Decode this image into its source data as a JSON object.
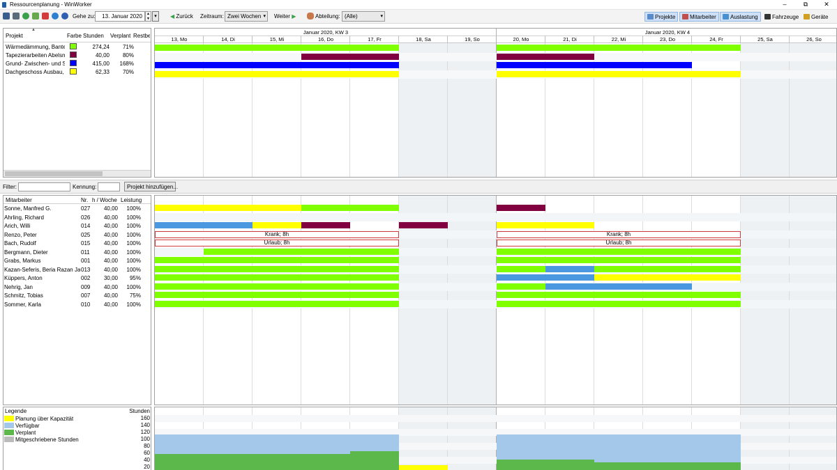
{
  "window": {
    "title": "Ressourcenplanung - WinWorker",
    "minimize": "–",
    "maximize": "⧉",
    "close": "✕"
  },
  "toolbar": {
    "icons": [
      "save-icon",
      "print-icon",
      "refresh-icon",
      "export-icon",
      "calendar-cancel-icon",
      "globe-icon",
      "help-icon"
    ],
    "goto_label": "Gehe zu:",
    "goto_date": "13. Januar 2020",
    "back_label": "Zurück",
    "range_label": "Zeitraum:",
    "range_value": "Zwei Wochen",
    "next_label": "Weiter",
    "dept_label": "Abteilung:",
    "dept_value": "(Alle)",
    "views": [
      {
        "label": "Projekte",
        "active": true
      },
      {
        "label": "Mitarbeiter",
        "active": true
      },
      {
        "label": "Auslastung",
        "active": true
      },
      {
        "label": "Fahrzeuge",
        "active": false
      },
      {
        "label": "Geräte",
        "active": false
      }
    ]
  },
  "projects": {
    "headers": {
      "name": "Projekt",
      "color": "Farbe",
      "hours": "Stunden",
      "planned": "Verplant",
      "rest": "Restbed"
    },
    "rows": [
      {
        "name": "Wärmedämmung, Banter",
        "color": "#80ff00",
        "hours": "274,24",
        "planned": "71%"
      },
      {
        "name": "Tapezierarbeiten Abelsma",
        "color": "#800040",
        "hours": "40,00",
        "planned": "80%"
      },
      {
        "name": "Grund- Zwischen- und Sc",
        "color": "#0000ff",
        "hours": "415,00",
        "planned": "168%"
      },
      {
        "name": "Dachgeschoss Ausbau, Ba",
        "color": "#ffff00",
        "hours": "62,33",
        "planned": "70%"
      }
    ]
  },
  "filter": {
    "filter_label": "Filter:",
    "kennung_label": "Kennung:",
    "add_button": "Projekt hinzufügen..."
  },
  "calendar": {
    "weeks": [
      "Januar 2020, KW 3",
      "Januar 2020, KW 4"
    ],
    "days": [
      "13, Mo",
      "14, Di",
      "15, Mi",
      "16, Do",
      "17, Fr",
      "18, Sa",
      "19, So",
      "20, Mo",
      "21, Di",
      "22, Mi",
      "23, Do",
      "24, Fr",
      "25, Sa",
      "26, So"
    ],
    "weekend_days": [
      5,
      6,
      12,
      13
    ]
  },
  "project_bars": [
    {
      "row": 0,
      "start": 0,
      "end": 5,
      "color": "#80ff00"
    },
    {
      "row": 0,
      "start": 7,
      "end": 12,
      "color": "#80ff00"
    },
    {
      "row": 1,
      "start": 3,
      "end": 5,
      "color": "#800040"
    },
    {
      "row": 1,
      "start": 7,
      "end": 9,
      "color": "#800040"
    },
    {
      "row": 2,
      "start": 0,
      "end": 5,
      "color": "#0000ff"
    },
    {
      "row": 2,
      "start": 7,
      "end": 11,
      "color": "#0000ff"
    },
    {
      "row": 3,
      "start": 0,
      "end": 5,
      "color": "#ffff00"
    },
    {
      "row": 3,
      "start": 7,
      "end": 12,
      "color": "#ffff00"
    }
  ],
  "employees": {
    "headers": {
      "name": "Mitarbeiter",
      "nr": "Nr.",
      "hweek": "h / Woche",
      "perf": "Leistung"
    },
    "rows": [
      {
        "name": "Sonne, Manfred G.",
        "nr": "027",
        "hweek": "40,00",
        "perf": "100%"
      },
      {
        "name": "Ahrling, Richard",
        "nr": "026",
        "hweek": "40,00",
        "perf": "100%"
      },
      {
        "name": "Arich, Willi",
        "nr": "014",
        "hweek": "40,00",
        "perf": "100%"
      },
      {
        "name": "Renzo, Peter",
        "nr": "025",
        "hweek": "40,00",
        "perf": "100%"
      },
      {
        "name": "Bach, Rudolf",
        "nr": "015",
        "hweek": "40,00",
        "perf": "100%"
      },
      {
        "name": "Bergmann, Dieter",
        "nr": "011",
        "hweek": "40,00",
        "perf": "100%"
      },
      {
        "name": "Grabs, Markus",
        "nr": "001",
        "hweek": "40,00",
        "perf": "100%"
      },
      {
        "name": "Kazan-Seferis, Beria Razan Janset",
        "nr": "013",
        "hweek": "40,00",
        "perf": "100%"
      },
      {
        "name": "Küppers, Anton",
        "nr": "002",
        "hweek": "30,00",
        "perf": "95%"
      },
      {
        "name": "Nehrig, Jan",
        "nr": "009",
        "hweek": "40,00",
        "perf": "100%"
      },
      {
        "name": "Schmitz, Tobias",
        "nr": "007",
        "hweek": "40,00",
        "perf": "75%"
      },
      {
        "name": "Sommer, Karla",
        "nr": "010",
        "hweek": "40,00",
        "perf": "100%"
      }
    ]
  },
  "employee_bars": [
    {
      "row": 0,
      "start": 0,
      "end": 3,
      "color": "#ffff00"
    },
    {
      "row": 0,
      "start": 3,
      "end": 5,
      "color": "#80ff00"
    },
    {
      "row": 0,
      "start": 7,
      "end": 8,
      "color": "#800040"
    },
    {
      "row": 2,
      "start": 0,
      "end": 2,
      "color": "#4a98e0"
    },
    {
      "row": 2,
      "start": 2,
      "end": 3,
      "color": "#ffff00"
    },
    {
      "row": 2,
      "start": 3,
      "end": 4,
      "color": "#800040"
    },
    {
      "row": 2,
      "start": 5,
      "end": 6,
      "color": "#800040"
    },
    {
      "row": 2,
      "start": 7,
      "end": 9,
      "color": "#ffff00"
    },
    {
      "row": 5,
      "start": 1,
      "end": 5,
      "color": "#80ff00"
    },
    {
      "row": 5,
      "start": 7,
      "end": 12,
      "color": "#80ff00"
    },
    {
      "row": 6,
      "start": 0,
      "end": 5,
      "color": "#80ff00"
    },
    {
      "row": 6,
      "start": 7,
      "end": 12,
      "color": "#80ff00"
    },
    {
      "row": 7,
      "start": 0,
      "end": 5,
      "color": "#80ff00"
    },
    {
      "row": 7,
      "start": 7,
      "end": 8,
      "color": "#80ff00"
    },
    {
      "row": 7,
      "start": 8,
      "end": 9,
      "color": "#4a98e0"
    },
    {
      "row": 7,
      "start": 9,
      "end": 12,
      "color": "#80ff00"
    },
    {
      "row": 8,
      "start": 0,
      "end": 5,
      "color": "#80ff00"
    },
    {
      "row": 8,
      "start": 7,
      "end": 9,
      "color": "#4a98e0"
    },
    {
      "row": 8,
      "start": 9,
      "end": 12,
      "color": "#ffff00"
    },
    {
      "row": 9,
      "start": 0,
      "end": 5,
      "color": "#80ff00"
    },
    {
      "row": 9,
      "start": 7,
      "end": 8,
      "color": "#80ff00"
    },
    {
      "row": 9,
      "start": 8,
      "end": 11,
      "color": "#4a98e0"
    },
    {
      "row": 10,
      "start": 0,
      "end": 5,
      "color": "#80ff00"
    },
    {
      "row": 10,
      "start": 7,
      "end": 12,
      "color": "#80ff00"
    },
    {
      "row": 11,
      "start": 0,
      "end": 5,
      "color": "#80ff00"
    },
    {
      "row": 11,
      "start": 7,
      "end": 12,
      "color": "#80ff00"
    }
  ],
  "absences": [
    {
      "row": 3,
      "start": 0,
      "end": 5,
      "label": "Krank; 8h"
    },
    {
      "row": 3,
      "start": 7,
      "end": 12,
      "label": "Krank; 8h"
    },
    {
      "row": 4,
      "start": 0,
      "end": 5,
      "label": "Urlaub; 8h"
    },
    {
      "row": 4,
      "start": 7,
      "end": 12,
      "label": "Urlaub; 8h"
    }
  ],
  "legend": {
    "title": "Legende",
    "unit_label": "Stunden",
    "items": [
      {
        "label": "Planung über Kapazität",
        "color": "#ffff00"
      },
      {
        "label": "Verfügbar",
        "color": "#a4c8ea"
      },
      {
        "label": "Verplant",
        "color": "#5cb84a"
      },
      {
        "label": "Mitgeschriebene Stunden",
        "color": "#bbbbbb"
      }
    ],
    "y_ticks": [
      "160",
      "140",
      "120",
      "100",
      "80",
      "60",
      "40",
      "20"
    ]
  },
  "chart_data": {
    "type": "bar",
    "categories": [
      "13, Mo",
      "14, Di",
      "15, Mi",
      "16, Do",
      "17, Fr",
      "18, Sa",
      "19, So",
      "20, Mo",
      "21, Di",
      "22, Mi",
      "23, Do",
      "24, Fr",
      "25, Sa",
      "26, So"
    ],
    "ylabel": "Stunden",
    "ylim": [
      0,
      160
    ],
    "series": [
      {
        "name": "Verfügbar",
        "values": [
          104,
          104,
          104,
          104,
          104,
          0,
          0,
          104,
          104,
          104,
          104,
          104,
          0,
          0
        ]
      },
      {
        "name": "Verplant",
        "values": [
          48,
          48,
          48,
          48,
          56,
          0,
          0,
          32,
          32,
          24,
          24,
          24,
          0,
          0
        ]
      },
      {
        "name": "Planung über Kapazität",
        "values": [
          0,
          0,
          0,
          0,
          0,
          16,
          0,
          0,
          0,
          0,
          0,
          0,
          0,
          0
        ]
      }
    ]
  }
}
